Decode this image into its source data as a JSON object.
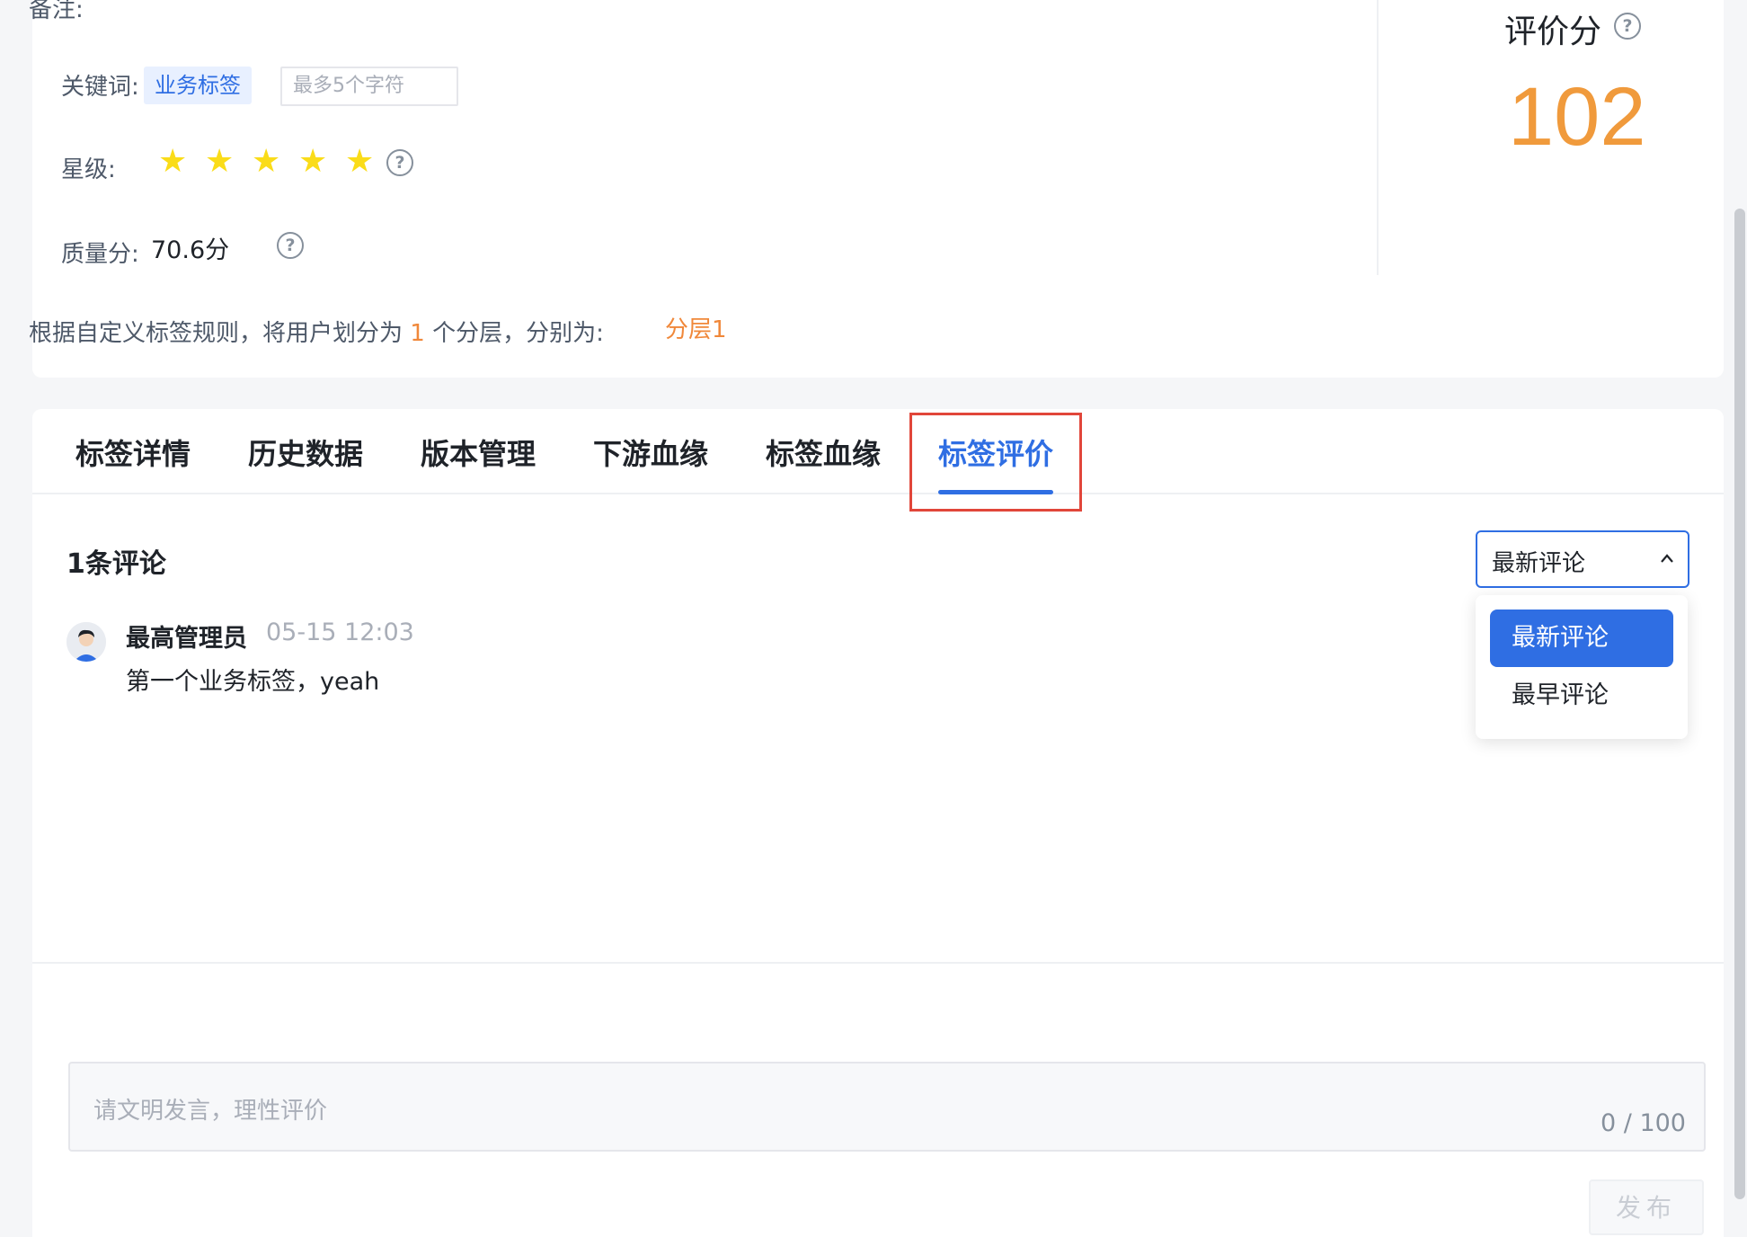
{
  "info": {
    "cut_label": "备注:",
    "keyword_label": "关键词:",
    "keyword_tag": "业务标签",
    "keyword_placeholder": "最多5个字符",
    "star_label": "星级:",
    "star_rating": 5,
    "quality_label": "质量分:",
    "quality_value": "70.6分",
    "layer_prefix": "根据自定义标签规则，将用户划分为",
    "layer_count": "1",
    "layer_suffix": "个分层，分别为:",
    "layer_name": "分层1"
  },
  "score": {
    "title": "评价分",
    "value": "102"
  },
  "tabs": [
    {
      "label": "标签详情"
    },
    {
      "label": "历史数据"
    },
    {
      "label": "版本管理"
    },
    {
      "label": "下游血缘"
    },
    {
      "label": "标签血缘"
    },
    {
      "label": "标签评价"
    }
  ],
  "active_tab": "标签评价",
  "comments": {
    "count_title": "1条评论",
    "sort": {
      "selected": "最新评论",
      "options": [
        "最新评论",
        "最早评论"
      ]
    },
    "items": [
      {
        "author": "最高管理员",
        "time": "05-15 12:03",
        "text": "第一个业务标签，yeah"
      }
    ]
  },
  "compose": {
    "placeholder": "请文明发言，理性评价",
    "counter": "0 / 100",
    "publish_label": "发布"
  },
  "colors": {
    "primary": "#2f6ee3",
    "orange": "#f09a3c",
    "highlight_red": "#e1463a",
    "star": "#fadc19"
  }
}
